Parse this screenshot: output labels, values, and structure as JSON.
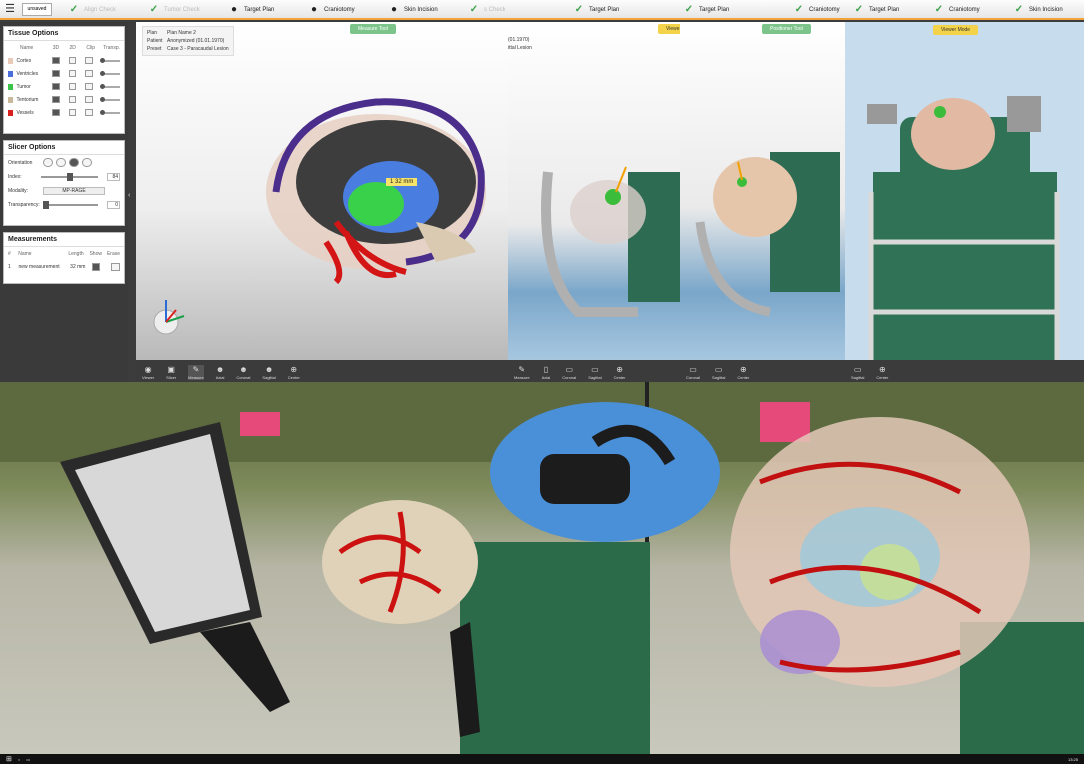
{
  "app": {
    "menu_icon": "hamburger-icon",
    "doc_status": "unsaved"
  },
  "steps_main": [
    {
      "label": "Align Check",
      "icon": "check-icon",
      "dim": true
    },
    {
      "label": "Tumor Check",
      "icon": "check-icon",
      "dim": true
    },
    {
      "label": "Target Plan",
      "icon": "head-icon",
      "dim": false
    },
    {
      "label": "Craniotomy",
      "icon": "head-icon",
      "dim": false
    },
    {
      "label": "Skin Incision",
      "icon": "head-icon",
      "dim": false
    },
    {
      "label": "s Check",
      "icon": "",
      "dim": true
    }
  ],
  "steps_mid": [
    {
      "label": "Target Plan"
    },
    {
      "label": "Target Plan"
    },
    {
      "label": "Craniotomy"
    }
  ],
  "steps_right": [
    {
      "label": "Target Plan"
    },
    {
      "label": "Craniotomy"
    },
    {
      "label": "Skin Incision"
    }
  ],
  "tissue": {
    "title": "Tissue Options",
    "headers": [
      "Name",
      "3D",
      "2D",
      "Clip",
      "Transp."
    ],
    "rows": [
      {
        "name": "Cortex",
        "color": "#e9c9b8"
      },
      {
        "name": "Ventricles",
        "color": "#4a6fd8"
      },
      {
        "name": "Tumor",
        "color": "#3cc44a"
      },
      {
        "name": "Tentorium",
        "color": "#c9b89a"
      },
      {
        "name": "Vessels",
        "color": "#d8201f"
      }
    ]
  },
  "slicer": {
    "title": "Slicer Options",
    "orientation_label": "Orientation",
    "index_label": "Index:",
    "index_value": "84",
    "modality_label": "Modality:",
    "modality_value": "MP-RAGE",
    "transparency_label": "Transparency:",
    "transparency_value": "0"
  },
  "measurements": {
    "title": "Measurements",
    "headers": [
      "#",
      "Name",
      "Length",
      "Show",
      "Erase"
    ],
    "rows": [
      {
        "num": "1",
        "name": "new measurement",
        "length": "32 mm"
      }
    ]
  },
  "plan_info": {
    "plan_label": "Plan",
    "plan_value": "Plan Name 2",
    "patient_label": "Patient",
    "patient_value": "Anonymized (01.01.1970)",
    "preset_label": "Preset",
    "preset_value": "Case 3 - Paracaudal Lesion"
  },
  "mid_info": {
    "line1": "(01.1970)",
    "line2": "ittal Lesion"
  },
  "buttons": {
    "measure_tool": "Measure Tool",
    "viewer": "Viewe",
    "position_tool": "Positioner Tool",
    "viewer_mode": "Viewer Mode"
  },
  "measure_label": "1  32 mm",
  "toolbar_main": [
    {
      "label": "Viewer",
      "icon": "eye-icon",
      "glyph": "◉"
    },
    {
      "label": "Slicer",
      "icon": "slicer-icon",
      "glyph": "▣"
    },
    {
      "label": "Measure",
      "icon": "ruler-icon",
      "glyph": "✎"
    },
    {
      "label": "Axial",
      "icon": "axial-icon",
      "glyph": "☻"
    },
    {
      "label": "Coronal",
      "icon": "coronal-icon",
      "glyph": "☻"
    },
    {
      "label": "Sagittal",
      "icon": "sagittal-icon",
      "glyph": "☻"
    },
    {
      "label": "Center",
      "icon": "center-icon",
      "glyph": "⊕"
    }
  ],
  "toolbar_mid": [
    {
      "label": "Measure",
      "icon": "ruler-icon",
      "glyph": "✎"
    },
    {
      "label": "Axial",
      "icon": "axial-icon",
      "glyph": "▯"
    },
    {
      "label": "Coronal",
      "icon": "coronal-icon",
      "glyph": "▭"
    },
    {
      "label": "Sagittal",
      "icon": "sagittal-icon",
      "glyph": "▭"
    },
    {
      "label": "Center",
      "icon": "center-icon",
      "glyph": "⊕"
    }
  ],
  "toolbar_r1": [
    {
      "label": "Coronal",
      "icon": "coronal-icon",
      "glyph": "▭"
    },
    {
      "label": "Sagittal",
      "icon": "sagittal-icon",
      "glyph": "▭"
    },
    {
      "label": "Center",
      "icon": "center-icon",
      "glyph": "⊕"
    }
  ],
  "toolbar_r2": [
    {
      "label": "Sagittal",
      "icon": "sagittal-icon",
      "glyph": "▭"
    },
    {
      "label": "Center",
      "icon": "center-icon",
      "glyph": "⊕"
    }
  ],
  "taskbar": {
    "clock": "13:25"
  },
  "colors": {
    "accent": "#f1a33a",
    "green": "#3aa14a",
    "vr_ellipse": "#4a90d9"
  }
}
